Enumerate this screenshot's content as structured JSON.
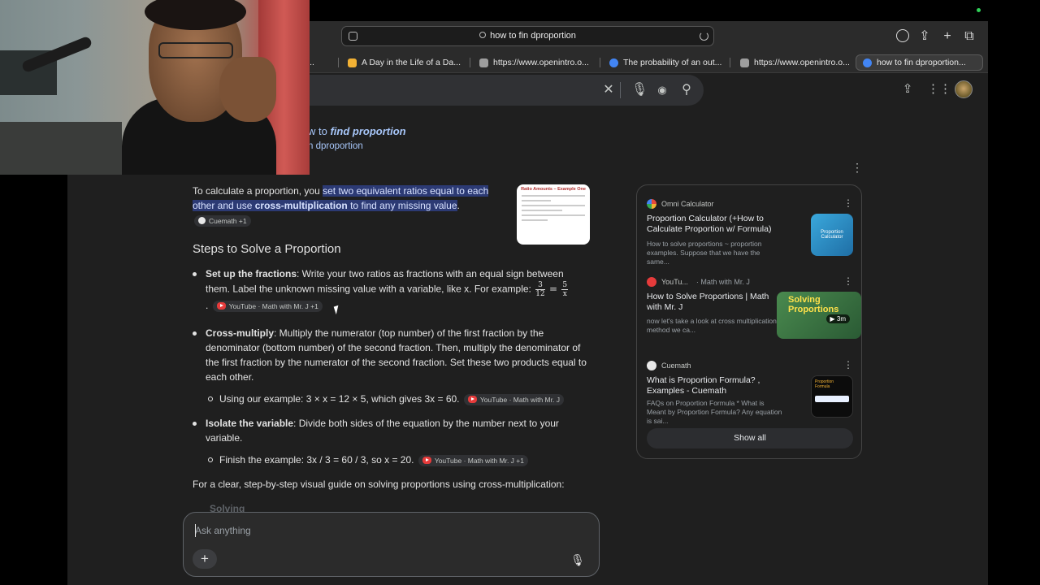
{
  "browser": {
    "address_text": "how to fin dproportion",
    "tabs": [
      {
        "label": "al...",
        "color": "#888888"
      },
      {
        "label": "A Day in the Life of a Da...",
        "color": "#f2b134"
      },
      {
        "label": "https://www.openintro.o...",
        "color": "#9e9e9e"
      },
      {
        "label": "The probability of an out...",
        "color": "#4285f4"
      },
      {
        "label": "https://www.openintro.o...",
        "color": "#9e9e9e"
      },
      {
        "label": "how to fin dproportion...",
        "color": "#4285f4",
        "active": true
      }
    ]
  },
  "query": {
    "prefix": "w to ",
    "title_bold": "find proportion",
    "subtitle": "n dproportion"
  },
  "ai_overview": {
    "intro_before": "To calculate a proportion, you ",
    "intro_hl1": "set two equivalent ratios equal to each other and use ",
    "intro_hl_bold": "cross-multiplication",
    "intro_hl2": " to find any missing value",
    "intro_after": ".",
    "intro_chip": "Cuemath +1",
    "steps_heading": "Steps to Solve a Proportion",
    "step1_bold": "Set up the fractions",
    "step1_text": ": Write your two ratios as fractions with an equal sign between them. Label the unknown missing value with a variable, like x. For example: ",
    "step1_frac": {
      "n1": "3",
      "d1": "12",
      "eq": "=",
      "n2": "5",
      "d2": "x"
    },
    "step1_chip": "YouTube · Math with Mr. J +1",
    "step1_period": ".",
    "step2_bold": "Cross-multiply",
    "step2_text": ": Multiply the numerator (top number) of the first fraction by the denominator (bottom number) of the second fraction. Then, multiply the denominator of the first fraction by the numerator of the second fraction. Set these two products equal to each other.",
    "step2_sub": "Using our example: 3 × x = 12 × 5, which gives 3x = 60.",
    "step2_chip": "YouTube · Math with Mr. J",
    "step3_bold": "Isolate the variable",
    "step3_text": ": Divide both sides of the equation by the number next to your variable.",
    "step3_sub": "Finish the example: 3x / 3 = 60 / 3, so x = 20.",
    "step3_chip": "YouTube · Math with Mr. J +1",
    "closing": "For a clear, step-by-step visual guide on solving proportions using cross-multiplication:",
    "faded": "Solving",
    "thumb_title": "Ratio Amounts – Example One"
  },
  "sources": {
    "cards": [
      {
        "site": "Omni Calculator",
        "sub": "",
        "title": "Proportion Calculator (+How to Calculate Proportion w/ Formula)",
        "snippet": "How to solve proportions ~ proportion examples. Suppose that we have the same...",
        "thumb_text": "Proportion Calculator",
        "thumb_color": "#2a8fc9"
      },
      {
        "site": "YouTu...",
        "sub": "· Math with Mr. J",
        "title": "How to Solve Proportions | Math with Mr. J",
        "snippet": "now let's take a look at cross multiplication a method we ca...",
        "thumb_text": "Solving Proportions",
        "thumb_duration": "3m",
        "thumb_color": "#2e6b3a"
      },
      {
        "site": "Cuemath",
        "sub": "",
        "title": "What is Proportion Formula? , Examples - Cuemath",
        "snippet": "FAQs on Proportion Formula * What is Meant by Proportion Formula? Any equation is sai...",
        "thumb_text": "Proportion Formula",
        "thumb_color": "#111111"
      }
    ],
    "show_all": "Show all"
  },
  "prompt": {
    "placeholder": "Ask anything"
  }
}
